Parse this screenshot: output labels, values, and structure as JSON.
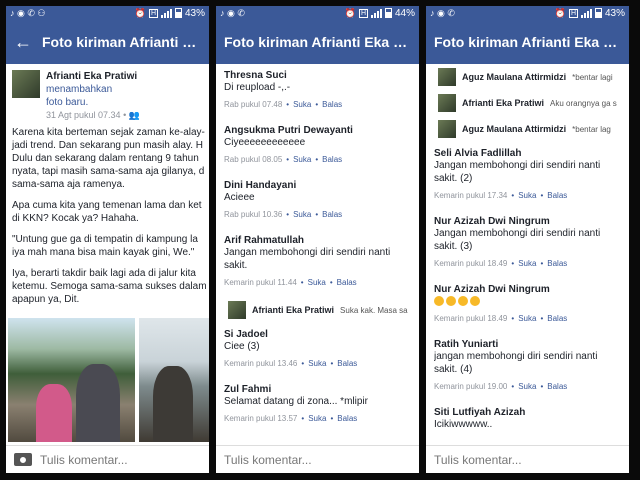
{
  "screens": [
    {
      "status": {
        "time_icons": "♪ ◉ ✆",
        "battery": "43%"
      },
      "header": {
        "title": "Foto kiriman Afrianti Eka P..."
      },
      "post": {
        "author": "Afrianti Eka Pratiwi",
        "action": "menambahkan",
        "action2": "foto baru.",
        "time": "31 Agt pukul 07.34 •",
        "lines": [
          "Karena kita berteman sejak zaman ke-alay-",
          "jadi trend. Dan sekarang pun masih alay. H",
          "Dulu dan sekarang dalam rentang 9 tahun",
          "nyata, tapi masih sama-sama aja gilanya, d",
          "sama-sama aja ramenya.",
          "Apa cuma kita yang temenan lama dan ket",
          "di KKN? Kocak ya? Hahaha.",
          "\"Untung gue ga di tempatin di kampung la",
          "iya mah mana bisa main kayak gini, We.\"",
          "Iya, berarti takdir baik lagi ada di jalur kita",
          "ketemu. Semoga sama-sama sukses dalam",
          "apapun ya, Dit."
        ]
      },
      "composer": {
        "placeholder": "Tulis komentar..."
      }
    },
    {
      "status": {
        "battery": "44%"
      },
      "header": {
        "title": "Foto kiriman Afrianti Eka P..."
      },
      "comments": [
        {
          "name": "Thresna Suci",
          "text": "Di reupload -,.-",
          "time": "Rab pukul 07.48",
          "like": "Suka",
          "reply": "Balas"
        },
        {
          "name": "Angsukma Putri Dewayanti",
          "text": "Ciyeeeeeeeeeeee",
          "time": "Rab pukul 08.05",
          "like": "Suka",
          "reply": "Balas"
        },
        {
          "name": "Dini Handayani",
          "text": "Acieee",
          "time": "Rab pukul 10.36",
          "like": "Suka",
          "reply": "Balas"
        },
        {
          "name": "Arif Rahmatullah",
          "text": "Jangan membohongi diri sendiri nanti sakit.",
          "time": "Kemarin pukul 11.44",
          "like": "Suka",
          "reply": "Balas"
        },
        {
          "name": "Si Jadoel",
          "text": "Ciee (3)",
          "time": "Kemarin pukul 13.46",
          "like": "Suka",
          "reply": "Balas"
        },
        {
          "name": "Zul Fahmi",
          "text": "Selamat datang di zona... *mlipir",
          "time": "Kemarin pukul 13.57",
          "like": "Suka",
          "reply": "Balas"
        }
      ],
      "reply_preview": {
        "name": "Afrianti Eka Pratiwi",
        "text": "Suka kak. Masa sa"
      },
      "composer": {
        "placeholder": "Tulis komentar..."
      }
    },
    {
      "status": {
        "battery": "43%"
      },
      "header": {
        "title": "Foto kiriman Afrianti Eka P..."
      },
      "replies": [
        {
          "name": "Aguz Maulana Attirmidzi",
          "text": "*bentar lagi"
        },
        {
          "name": "Afrianti Eka Pratiwi",
          "text": "Aku orangnya ga s"
        },
        {
          "name": "Aguz Maulana Attirmidzi",
          "text": "*bentar lag"
        }
      ],
      "comments": [
        {
          "name": "Seli Alvia Fadlillah",
          "text": "Jangan membohongi diri sendiri nanti sakit. (2)",
          "time": "Kemarin pukul 17.34",
          "like": "Suka",
          "reply": "Balas"
        },
        {
          "name": "Nur Azizah Dwi Ningrum",
          "text": "Jangan membohongi diri sendiri nanti sakit. (3)",
          "time": "Kemarin pukul 18.49",
          "like": "Suka",
          "reply": "Balas"
        },
        {
          "name": "Nur Azizah Dwi Ningrum",
          "text": "",
          "time": "Kemarin pukul 18.49",
          "like": "Suka",
          "reply": "Balas"
        },
        {
          "name": "Ratih Yuniarti",
          "text": "jangan membohongi diri sendiri nanti sakit. (4)",
          "time": "Kemarin pukul 19.00",
          "like": "Suka",
          "reply": "Balas"
        },
        {
          "name": "Siti Lutfiyah Azizah",
          "text": "Icikiwwwww..",
          "time": "",
          "like": "",
          "reply": ""
        }
      ],
      "composer": {
        "placeholder": "Tulis komentar..."
      }
    }
  ],
  "colors": {
    "brand": "#3b5998",
    "meta": "#90949c",
    "emoji": "#f7b928"
  }
}
